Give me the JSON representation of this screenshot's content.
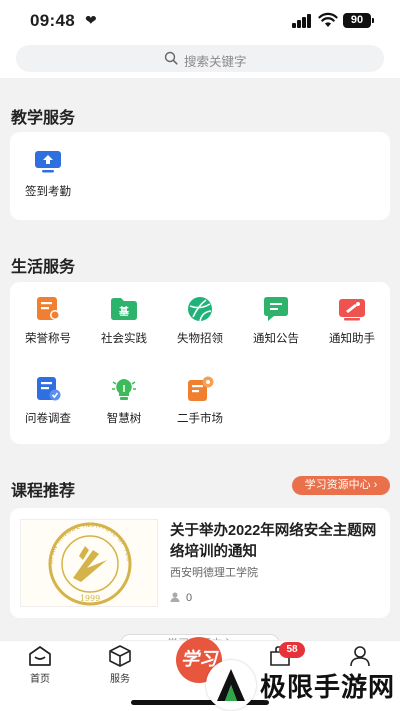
{
  "status_bar": {
    "time": "09:48",
    "battery": "90"
  },
  "search": {
    "placeholder": "搜索关键字"
  },
  "teaching": {
    "title": "教学服务",
    "items": [
      {
        "label": "签到考勤",
        "icon": "monitor-upload-icon",
        "color": "#2f6fe0"
      }
    ]
  },
  "life": {
    "title": "生活服务",
    "items": [
      {
        "label": "荣誉称号",
        "icon": "honor-certificate-icon",
        "color": "#f08030"
      },
      {
        "label": "社会实践",
        "icon": "folder-base-icon",
        "color": "#2db36c"
      },
      {
        "label": "失物招领",
        "icon": "ball-icon",
        "color": "#1fb37a"
      },
      {
        "label": "通知公告",
        "icon": "message-icon",
        "color": "#2fb36c"
      },
      {
        "label": "通知助手",
        "icon": "megaphone-icon",
        "color": "#ef5350"
      },
      {
        "label": "问卷调查",
        "icon": "survey-icon",
        "color": "#2f6fe0"
      },
      {
        "label": "智慧树",
        "icon": "lightbulb-tree-icon",
        "color": "#3dbb5a"
      },
      {
        "label": "二手市场",
        "icon": "market-icon",
        "color": "#f08030"
      }
    ]
  },
  "courses": {
    "title": "课程推荐",
    "more_label": "学习资源中心 ›",
    "list": [
      {
        "title": "关于举办2022年网络安全主题网络培训的通知",
        "school": "西安明德理工学院",
        "views": "0",
        "seal_text": "XI'AN MINGDE INSTITUTE OF TECHNOLOGY",
        "seal_year": "1999"
      }
    ]
  },
  "tabbar": {
    "home": "首页",
    "service": "服务",
    "center": "学习",
    "badge": "58"
  },
  "peek_label": "学习资源中心",
  "watermark": "极限手游网",
  "colors": {
    "accent": "#e9704a",
    "center_tab": "#e8563e",
    "badge": "#e8323a",
    "seal_gold": "#d4b34a"
  }
}
